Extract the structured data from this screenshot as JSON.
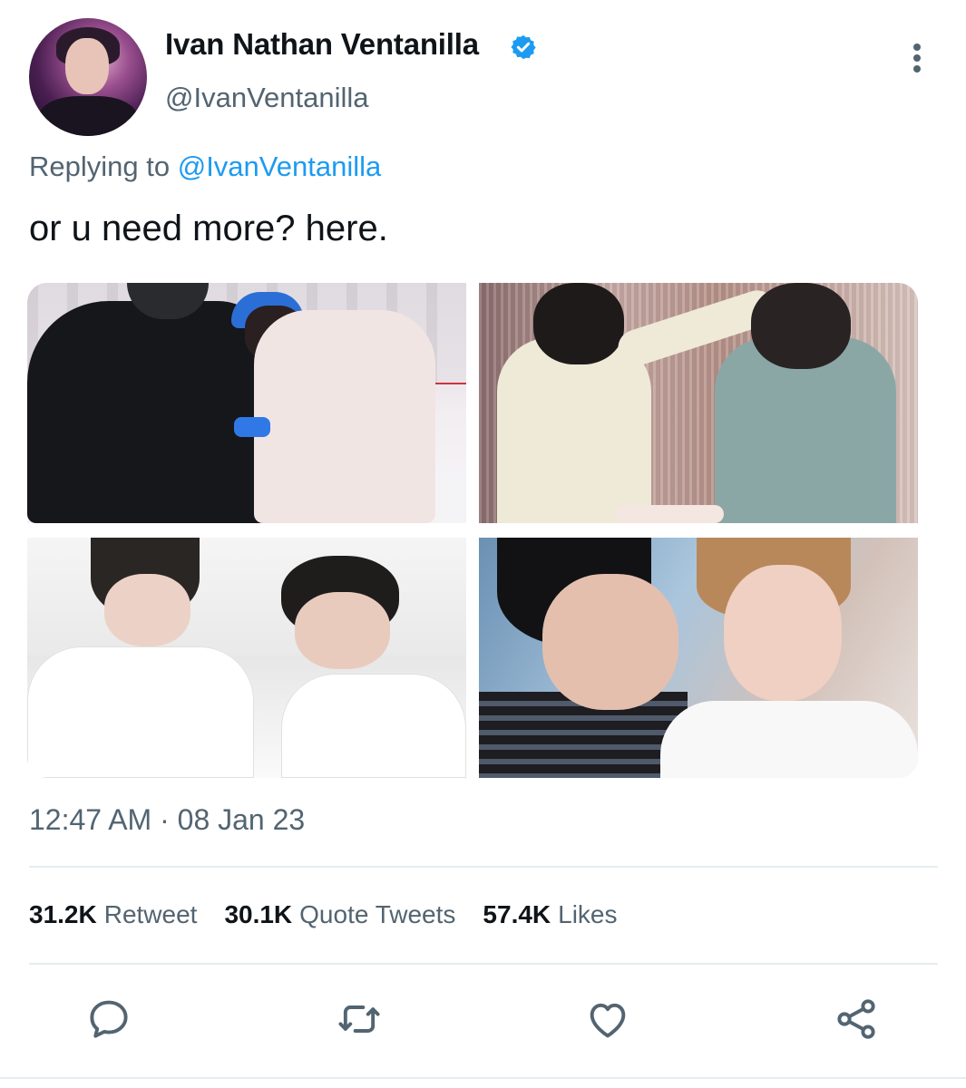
{
  "author": {
    "display_name": "Ivan Nathan Ventanilla",
    "handle": "@IvanVentanilla",
    "verified": true
  },
  "reply": {
    "prefix": "Replying to",
    "mention": "@IvanVentanilla"
  },
  "tweet": {
    "text": "or u need more? here.",
    "timestamp": "12:47 AM · 08 Jan 23"
  },
  "stats": [
    {
      "count": "31.2K",
      "label": "Retweet"
    },
    {
      "count": "30.1K",
      "label": "Quote Tweets"
    },
    {
      "count": "57.4K",
      "label": "Likes"
    }
  ],
  "icons": {
    "verified": "verified-badge-icon",
    "more": "more-vertical-icon",
    "reply": "reply-icon",
    "retweet": "retweet-icon",
    "like": "heart-icon",
    "share": "share-icon"
  },
  "colors": {
    "accent": "#1d9bf0",
    "text": "#0f1419",
    "secondary": "#536471",
    "divider": "#e6ecf0"
  }
}
